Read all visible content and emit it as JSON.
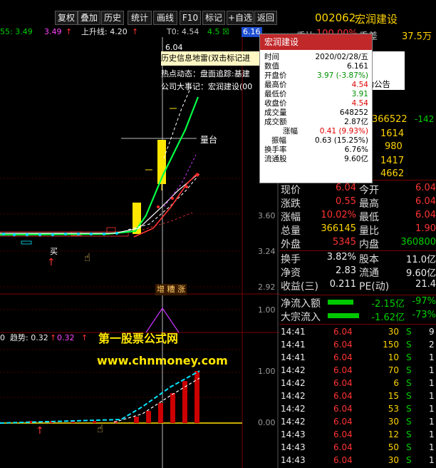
{
  "toolbar": {
    "buttons": [
      "复权",
      "叠加",
      "历史",
      "统计",
      "画线",
      "F10",
      "标记",
      "+自选",
      "返回"
    ]
  },
  "stock": {
    "code": "002062",
    "name": "宏润建设"
  },
  "top_indicator": {
    "ma_label": "55: 3.49",
    "ma_val2": "3.49",
    "rise_line": "上升线: 4.20",
    "t0": "T0: 4.54",
    "t0_extra": "4.5",
    "price_tag": "6.16"
  },
  "main_prices": {
    "p1": "3.60",
    "p2": "3.24",
    "p3": "2.92",
    "peak": "6.04",
    "sub1": "1.00",
    "sub2": "0.00"
  },
  "chart_labels": {
    "buy": "买",
    "tags": "增 糟 涨",
    "platform": "量台",
    "dash": "—"
  },
  "info_overlay": {
    "headline": "历史信息地雷(双击标记进",
    "hot": "热点动态：盘面追踪:基建",
    "event": "公司大事记：宏润建设(00"
  },
  "popup": {
    "title": "宏润建设",
    "rows": [
      {
        "label": "时间",
        "value": "2020/02/28/五",
        "color": "#000000"
      },
      {
        "label": "数值",
        "value": "6.161",
        "color": "#000000"
      },
      {
        "label": "开盘价",
        "value": "3.97 (-3.87%)",
        "color": "#009000"
      },
      {
        "label": "最高价",
        "value": "4.54",
        "color": "#e00000"
      },
      {
        "label": "最低价",
        "value": "3.91",
        "color": "#009000"
      },
      {
        "label": "收盘价",
        "value": "4.54",
        "color": "#e00000"
      },
      {
        "label": "成交量",
        "value": "648252",
        "color": "#000000"
      },
      {
        "label": "成交额",
        "value": "2.87亿",
        "color": "#000000"
      },
      {
        "label": "涨幅",
        "value": "0.41 (9.93%)",
        "color": "#e00000"
      },
      {
        "label": "振幅",
        "value": "0.63 (15.25%)",
        "color": "#000000"
      },
      {
        "label": "换手率",
        "value": "6.76%",
        "color": "#000000"
      },
      {
        "label": "流通股",
        "value": "9.60亿",
        "color": "#000000"
      }
    ]
  },
  "panel_top": {
    "wei_bi": "委比",
    "wei_bi_val": "100.00%",
    "wei_cha": "委差",
    "wei_cha_val": "37.5万",
    "notice": "披动公告",
    "rows": [
      {
        "a": "366522",
        "b": "-142"
      },
      {
        "a": "1614",
        "b": ""
      },
      {
        "a": "980",
        "b": ""
      },
      {
        "a": "1417",
        "b": ""
      },
      {
        "a": "4662",
        "b": ""
      }
    ]
  },
  "quote": [
    {
      "l1": "现价",
      "v1": "6.04",
      "l2": "今开",
      "v2": "6.04"
    },
    {
      "l1": "涨跌",
      "v1": "0.55",
      "l2": "最高",
      "v2": "6.04"
    },
    {
      "l1": "涨幅",
      "v1": "10.02%",
      "l2": "最低",
      "v2": "6.04"
    },
    {
      "l1": "总量",
      "v1": "366145",
      "l2": "量比",
      "v2": "1.90"
    },
    {
      "l1": "外盘",
      "v1": "5345",
      "l2": "内盘",
      "v2": "360800"
    }
  ],
  "quote2": [
    {
      "l1": "换手",
      "v1": "3.82%",
      "l2": "股本",
      "v2": "11.0亿"
    },
    {
      "l1": "净资",
      "v1": "2.83",
      "l2": "流通",
      "v2": "9.60亿"
    },
    {
      "l1": "收益(三)",
      "v1": "0.211",
      "l2": "PE(动)",
      "v2": "21.4"
    }
  ],
  "flows": [
    {
      "label": "净流入额",
      "value": "-2.15亿",
      "pct": "-97%"
    },
    {
      "label": "大宗流入",
      "value": "-1.62亿",
      "pct": "-73%"
    }
  ],
  "ticks": [
    {
      "time": "14:41",
      "price": "6.04",
      "vol": "30",
      "side": "S",
      "n": "9"
    },
    {
      "time": "14:41",
      "price": "6.04",
      "vol": "150",
      "side": "S",
      "n": "2"
    },
    {
      "time": "14:41",
      "price": "6.04",
      "vol": "10",
      "side": "S",
      "n": "1"
    },
    {
      "time": "14:42",
      "price": "6.04",
      "vol": "70",
      "side": "S",
      "n": "1"
    },
    {
      "time": "14:42",
      "price": "6.04",
      "vol": "6",
      "side": "S",
      "n": "1"
    },
    {
      "time": "14:42",
      "price": "6.04",
      "vol": "15",
      "side": "S",
      "n": "1"
    },
    {
      "time": "14:42",
      "price": "6.04",
      "vol": "53",
      "side": "S",
      "n": "1"
    },
    {
      "time": "14:42",
      "price": "6.04",
      "vol": "30",
      "side": "S",
      "n": "1"
    },
    {
      "time": "14:43",
      "price": "6.04",
      "vol": "12",
      "side": "S",
      "n": "1"
    },
    {
      "time": "14:43",
      "price": "6.04",
      "vol": "50",
      "side": "S",
      "n": "1"
    },
    {
      "time": "14:43",
      "price": "6.04",
      "vol": "30",
      "side": "S",
      "n": "1"
    }
  ],
  "sub_indicator": {
    "idx": "0",
    "trend": "趋势: 0.32",
    "trend2": "0.32"
  },
  "watermark": {
    "line1": "第一股票公式网",
    "line2": "www.chnmoney.com"
  },
  "colors": {
    "up": "#ff3333",
    "down": "#00d000",
    "accent": "#ffd400",
    "popup_title": "#c0282a"
  }
}
